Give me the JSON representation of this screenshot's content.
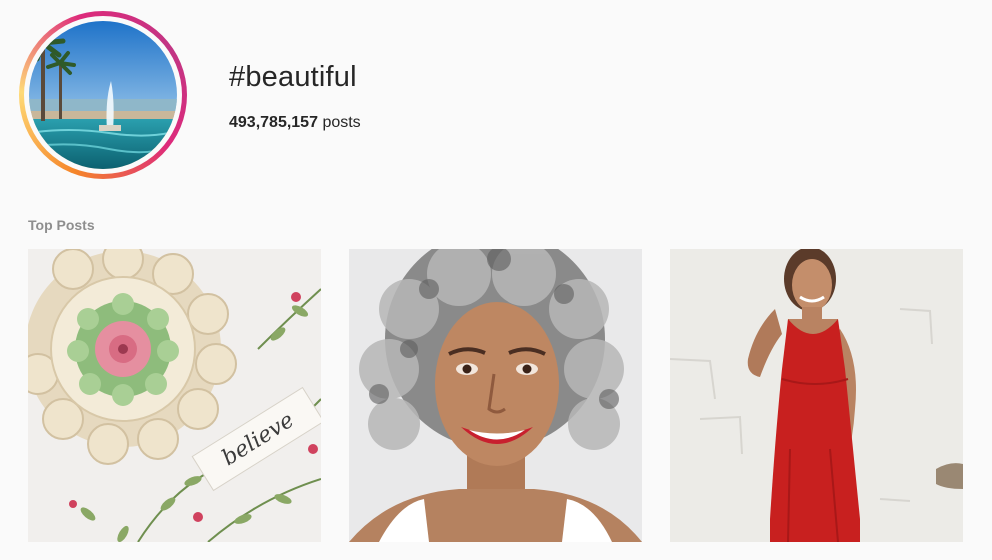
{
  "hashtag": {
    "title": "#beautiful",
    "post_count": "493,785,157",
    "post_count_suffix": "posts"
  },
  "sections": {
    "top_posts_label": "Top Posts"
  },
  "top_posts": [
    {
      "subject": "crochet flower with watercolor card",
      "card_text": "believe"
    },
    {
      "subject": "smiling woman with curly gray hair"
    },
    {
      "subject": "woman in red dress against white wall"
    }
  ],
  "colors": {
    "background": "#fafafa",
    "text": "#262626",
    "muted": "#8e8e8e",
    "ring_gradient": [
      "#f58529",
      "#dd2a7b",
      "#c13584"
    ]
  }
}
